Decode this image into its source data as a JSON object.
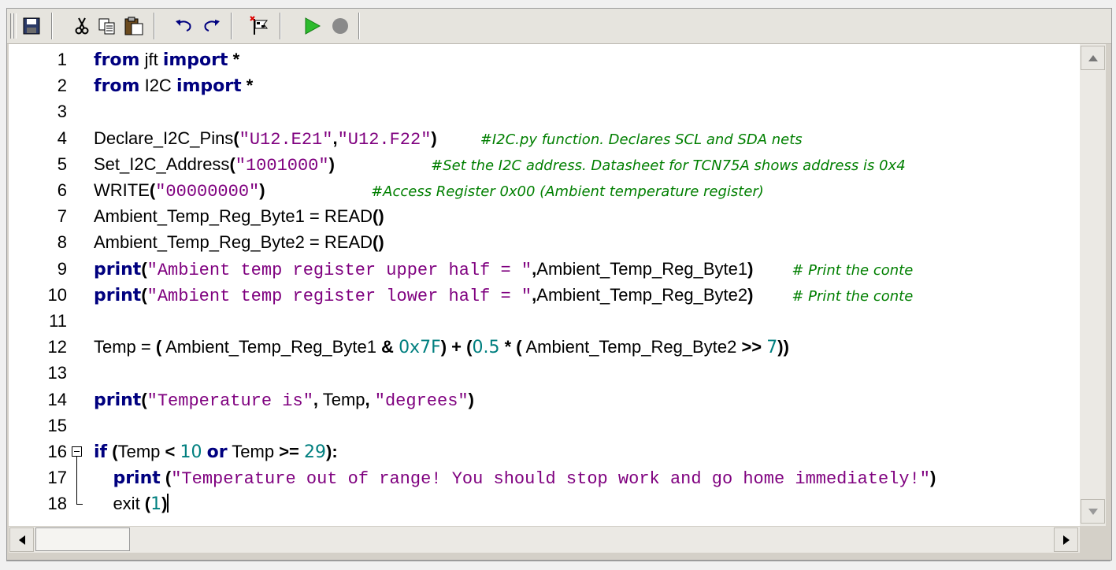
{
  "toolbar": {
    "buttons": [
      "save-icon",
      "cut-icon",
      "copy-icon",
      "paste-icon",
      "undo-icon",
      "redo-icon",
      "flag-icon",
      "run-icon",
      "stop-icon"
    ]
  },
  "editor": {
    "line_numbers": [
      "1",
      "2",
      "3",
      "4",
      "5",
      "6",
      "7",
      "8",
      "9",
      "10",
      "11",
      "12",
      "13",
      "14",
      "15",
      "16",
      "17",
      "18"
    ],
    "lines": [
      [
        {
          "t": "from",
          "c": "kw"
        },
        {
          "t": " jft ",
          "c": "sans"
        },
        {
          "t": "import",
          "c": "kw"
        },
        {
          "t": " *",
          "c": "op"
        }
      ],
      [
        {
          "t": "from",
          "c": "kw"
        },
        {
          "t": " I2C ",
          "c": "sans"
        },
        {
          "t": "import",
          "c": "kw"
        },
        {
          "t": " *",
          "c": "op"
        }
      ],
      [],
      [
        {
          "t": "Declare_I2C_Pins",
          "c": "sans"
        },
        {
          "t": "(",
          "c": "op"
        },
        {
          "t": "\"U12.E21\"",
          "c": "str"
        },
        {
          "t": ",",
          "c": "op"
        },
        {
          "t": "\"U12.F22\"",
          "c": "str"
        },
        {
          "t": ")",
          "c": "op"
        },
        {
          "t": "         ",
          "c": "sans"
        },
        {
          "t": "#I2C.py function. Declares SCL and SDA nets",
          "c": "cmt"
        }
      ],
      [
        {
          "t": "Set_I2C_Address",
          "c": "sans"
        },
        {
          "t": "(",
          "c": "op"
        },
        {
          "t": "\"1001000\"",
          "c": "str"
        },
        {
          "t": ")",
          "c": "op"
        },
        {
          "t": "                    ",
          "c": "sans"
        },
        {
          "t": "#Set the I2C address. Datasheet for TCN75A shows address is 0x4",
          "c": "cmt"
        }
      ],
      [
        {
          "t": "WRITE",
          "c": "sans"
        },
        {
          "t": "(",
          "c": "op"
        },
        {
          "t": "\"00000000\"",
          "c": "str"
        },
        {
          "t": ")",
          "c": "op"
        },
        {
          "t": "                      ",
          "c": "sans"
        },
        {
          "t": "#Access Register 0x00 (Ambient temperature register)",
          "c": "cmt"
        }
      ],
      [
        {
          "t": "Ambient_Temp_Reg_Byte1 = READ",
          "c": "sans"
        },
        {
          "t": "()",
          "c": "op"
        }
      ],
      [
        {
          "t": "Ambient_Temp_Reg_Byte2 = READ",
          "c": "sans"
        },
        {
          "t": "()",
          "c": "op"
        }
      ],
      [
        {
          "t": "print",
          "c": "kw"
        },
        {
          "t": "(",
          "c": "op"
        },
        {
          "t": "\"Ambient temp register upper half = \"",
          "c": "str"
        },
        {
          "t": ",",
          "c": "op"
        },
        {
          "t": "Ambient_Temp_Reg_Byte1",
          "c": "sans"
        },
        {
          "t": ")",
          "c": "op"
        },
        {
          "t": "        ",
          "c": "sans"
        },
        {
          "t": "# Print the conte",
          "c": "cmt"
        }
      ],
      [
        {
          "t": "print",
          "c": "kw"
        },
        {
          "t": "(",
          "c": "op"
        },
        {
          "t": "\"Ambient temp register lower half = \"",
          "c": "str"
        },
        {
          "t": ",",
          "c": "op"
        },
        {
          "t": "Ambient_Temp_Reg_Byte2",
          "c": "sans"
        },
        {
          "t": ")",
          "c": "op"
        },
        {
          "t": "        ",
          "c": "sans"
        },
        {
          "t": "# Print the conte",
          "c": "cmt"
        }
      ],
      [],
      [
        {
          "t": "Temp = ",
          "c": "sans"
        },
        {
          "t": "(",
          "c": "op"
        },
        {
          "t": " Ambient_Temp_Reg_Byte1 ",
          "c": "sans"
        },
        {
          "t": "&",
          "c": "op"
        },
        {
          "t": " ",
          "c": "sans"
        },
        {
          "t": "0x7F",
          "c": "num"
        },
        {
          "t": ") + (",
          "c": "op"
        },
        {
          "t": "0.5",
          "c": "num"
        },
        {
          "t": " * (",
          "c": "op"
        },
        {
          "t": " Ambient_Temp_Reg_Byte2 ",
          "c": "sans"
        },
        {
          "t": ">>",
          "c": "op"
        },
        {
          "t": " ",
          "c": "sans"
        },
        {
          "t": "7",
          "c": "num"
        },
        {
          "t": "))",
          "c": "op"
        }
      ],
      [],
      [
        {
          "t": "print",
          "c": "kw"
        },
        {
          "t": "(",
          "c": "op"
        },
        {
          "t": "\"Temperature is\"",
          "c": "str"
        },
        {
          "t": ",",
          "c": "op"
        },
        {
          "t": " Temp",
          "c": "sans"
        },
        {
          "t": ",",
          "c": "op"
        },
        {
          "t": " ",
          "c": "sans"
        },
        {
          "t": "\"degrees\"",
          "c": "str"
        },
        {
          "t": ")",
          "c": "op"
        }
      ],
      [],
      [
        {
          "t": "if",
          "c": "kw"
        },
        {
          "t": " (",
          "c": "op"
        },
        {
          "t": "Temp ",
          "c": "sans"
        },
        {
          "t": "<",
          "c": "op"
        },
        {
          "t": " ",
          "c": "sans"
        },
        {
          "t": "10",
          "c": "num"
        },
        {
          "t": " ",
          "c": "sans"
        },
        {
          "t": "or",
          "c": "kw"
        },
        {
          "t": " Temp ",
          "c": "sans"
        },
        {
          "t": ">=",
          "c": "op"
        },
        {
          "t": " ",
          "c": "sans"
        },
        {
          "t": "29",
          "c": "num"
        },
        {
          "t": "):",
          "c": "op"
        }
      ],
      [
        {
          "t": "    ",
          "c": "sans"
        },
        {
          "t": "print",
          "c": "kw"
        },
        {
          "t": " (",
          "c": "op"
        },
        {
          "t": "\"Temperature out of range! You should stop work and go home immediately!\"",
          "c": "str"
        },
        {
          "t": ")",
          "c": "op"
        }
      ],
      [
        {
          "t": "    exit ",
          "c": "sans"
        },
        {
          "t": "(",
          "c": "op"
        },
        {
          "t": "1",
          "c": "num"
        },
        {
          "t": ")",
          "c": "op"
        }
      ]
    ]
  }
}
